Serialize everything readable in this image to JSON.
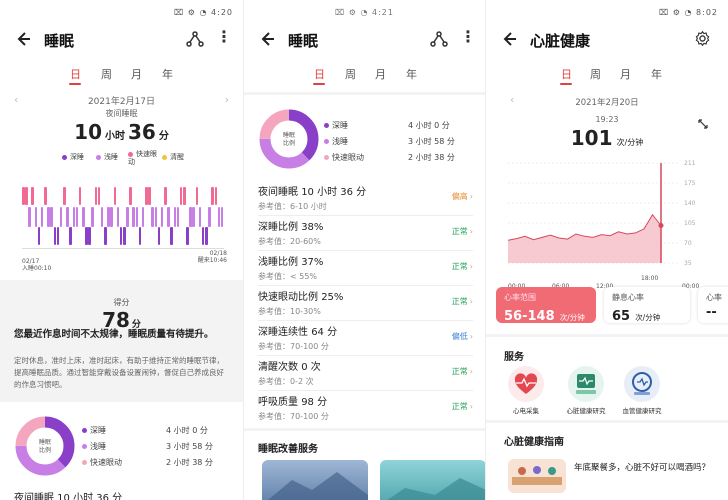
{
  "screen1": {
    "status_time": "4:20",
    "title": "睡眠",
    "tabs": [
      "日",
      "周",
      "月",
      "年"
    ],
    "date": "2021年2月17日",
    "night_label": "夜间睡眠",
    "duration_h": "10",
    "unit_h": "小时",
    "duration_m": "36",
    "unit_m": "分",
    "legend": [
      "深睡",
      "浅睡",
      "快速眼动",
      "清醒"
    ],
    "start_date": "02/17",
    "start_text": "入睡00:10",
    "end_date": "02/18",
    "end_text": "醒来10:46",
    "score_label": "得分",
    "score": "78",
    "score_unit": "分",
    "advice_title": "您最近作息时间不太规律，睡眠质量有待提升。",
    "advice_body": "定时休息，准时上床，准时起床，有助于维持正常的睡眠节律，提高睡眠品质。通过智能穿戴设备设置闹钟，督促自己养成良好的作息习惯吧。",
    "donut_center": "睡眠\n比例",
    "breakdown": [
      {
        "name": "深睡",
        "h": "4",
        "m": "0"
      },
      {
        "name": "浅睡",
        "h": "3",
        "m": "58"
      },
      {
        "name": "快速眼动",
        "h": "2",
        "m": "38"
      }
    ],
    "bottom_text": "夜间睡眠 10 小时 36 分"
  },
  "screen2": {
    "status_time": "4:21",
    "title": "睡眠",
    "tabs": [
      "日",
      "周",
      "月",
      "年"
    ],
    "donut_center": "睡眠\n比例",
    "breakdown": [
      {
        "name": "深睡",
        "value": "4 小时 0 分"
      },
      {
        "name": "浅睡",
        "value": "3 小时 58 分"
      },
      {
        "name": "快速眼动",
        "value": "2 小时 38 分"
      }
    ],
    "metrics": [
      {
        "label": "夜间睡眠",
        "value": "10 小时 36 分",
        "ref": "参考值：6-10 小时",
        "status": "偏高",
        "kind": "warn"
      },
      {
        "label": "深睡比例",
        "value": "38%",
        "ref": "参考值：20-60%",
        "status": "正常",
        "kind": "ok"
      },
      {
        "label": "浅睡比例",
        "value": "37%",
        "ref": "参考值：< 55%",
        "status": "正常",
        "kind": "ok"
      },
      {
        "label": "快速眼动比例",
        "value": "25%",
        "ref": "参考值：10-30%",
        "status": "正常",
        "kind": "ok"
      },
      {
        "label": "深睡连续性",
        "value": "64 分",
        "ref": "参考值：70-100 分",
        "status": "偏低",
        "kind": "low"
      },
      {
        "label": "清醒次数",
        "value": "0 次",
        "ref": "参考值：0-2 次",
        "status": "正常",
        "kind": "ok"
      },
      {
        "label": "呼吸质量",
        "value": "98 分",
        "ref": "参考值：70-100 分",
        "status": "正常",
        "kind": "ok"
      }
    ],
    "service_title": "睡眠改善服务"
  },
  "screen3": {
    "status_time": "8:02",
    "title": "心脏健康",
    "tabs": [
      "日",
      "周",
      "月",
      "年"
    ],
    "date": "2021年2月20日",
    "time": "19:23",
    "bpm": "101",
    "bpm_unit": "次/分钟",
    "y_ticks": [
      "211",
      "175",
      "140",
      "105",
      "70",
      "35"
    ],
    "x_ticks": [
      "00:00",
      "06:00",
      "12:00",
      "18:00",
      "00:00"
    ],
    "cards": [
      {
        "label": "心率范围",
        "value": "56-148",
        "unit": "次/分钟"
      },
      {
        "label": "静息心率",
        "value": "65",
        "unit": "次/分钟"
      },
      {
        "label": "心率",
        "value": "--",
        "unit": ""
      }
    ],
    "service_title": "服务",
    "services": [
      "心电采集",
      "心脏健康研究",
      "血管健康研究"
    ],
    "guide_title": "心脏健康指南",
    "guide_text": "年底聚餐多，心脏不好可以喝酒吗？",
    "colors": {
      "accent": "#e24040",
      "deep": "#8a3fc8",
      "light": "#c77fe6",
      "rem": "#f06a94",
      "awake": "#f2c23c"
    }
  },
  "chart_data": {
    "type": "area",
    "title": "",
    "xlabel": "",
    "ylabel": "次/分钟",
    "x_ticks": [
      "00:00",
      "06:00",
      "12:00",
      "18:00",
      "00:00"
    ],
    "ylim": [
      35,
      211
    ],
    "series": [
      {
        "values": [
          75,
          78,
          82,
          76,
          80,
          84,
          79,
          77,
          86,
          82,
          80,
          85,
          83,
          90,
          86,
          88,
          95,
          120,
          101
        ]
      }
    ]
  }
}
